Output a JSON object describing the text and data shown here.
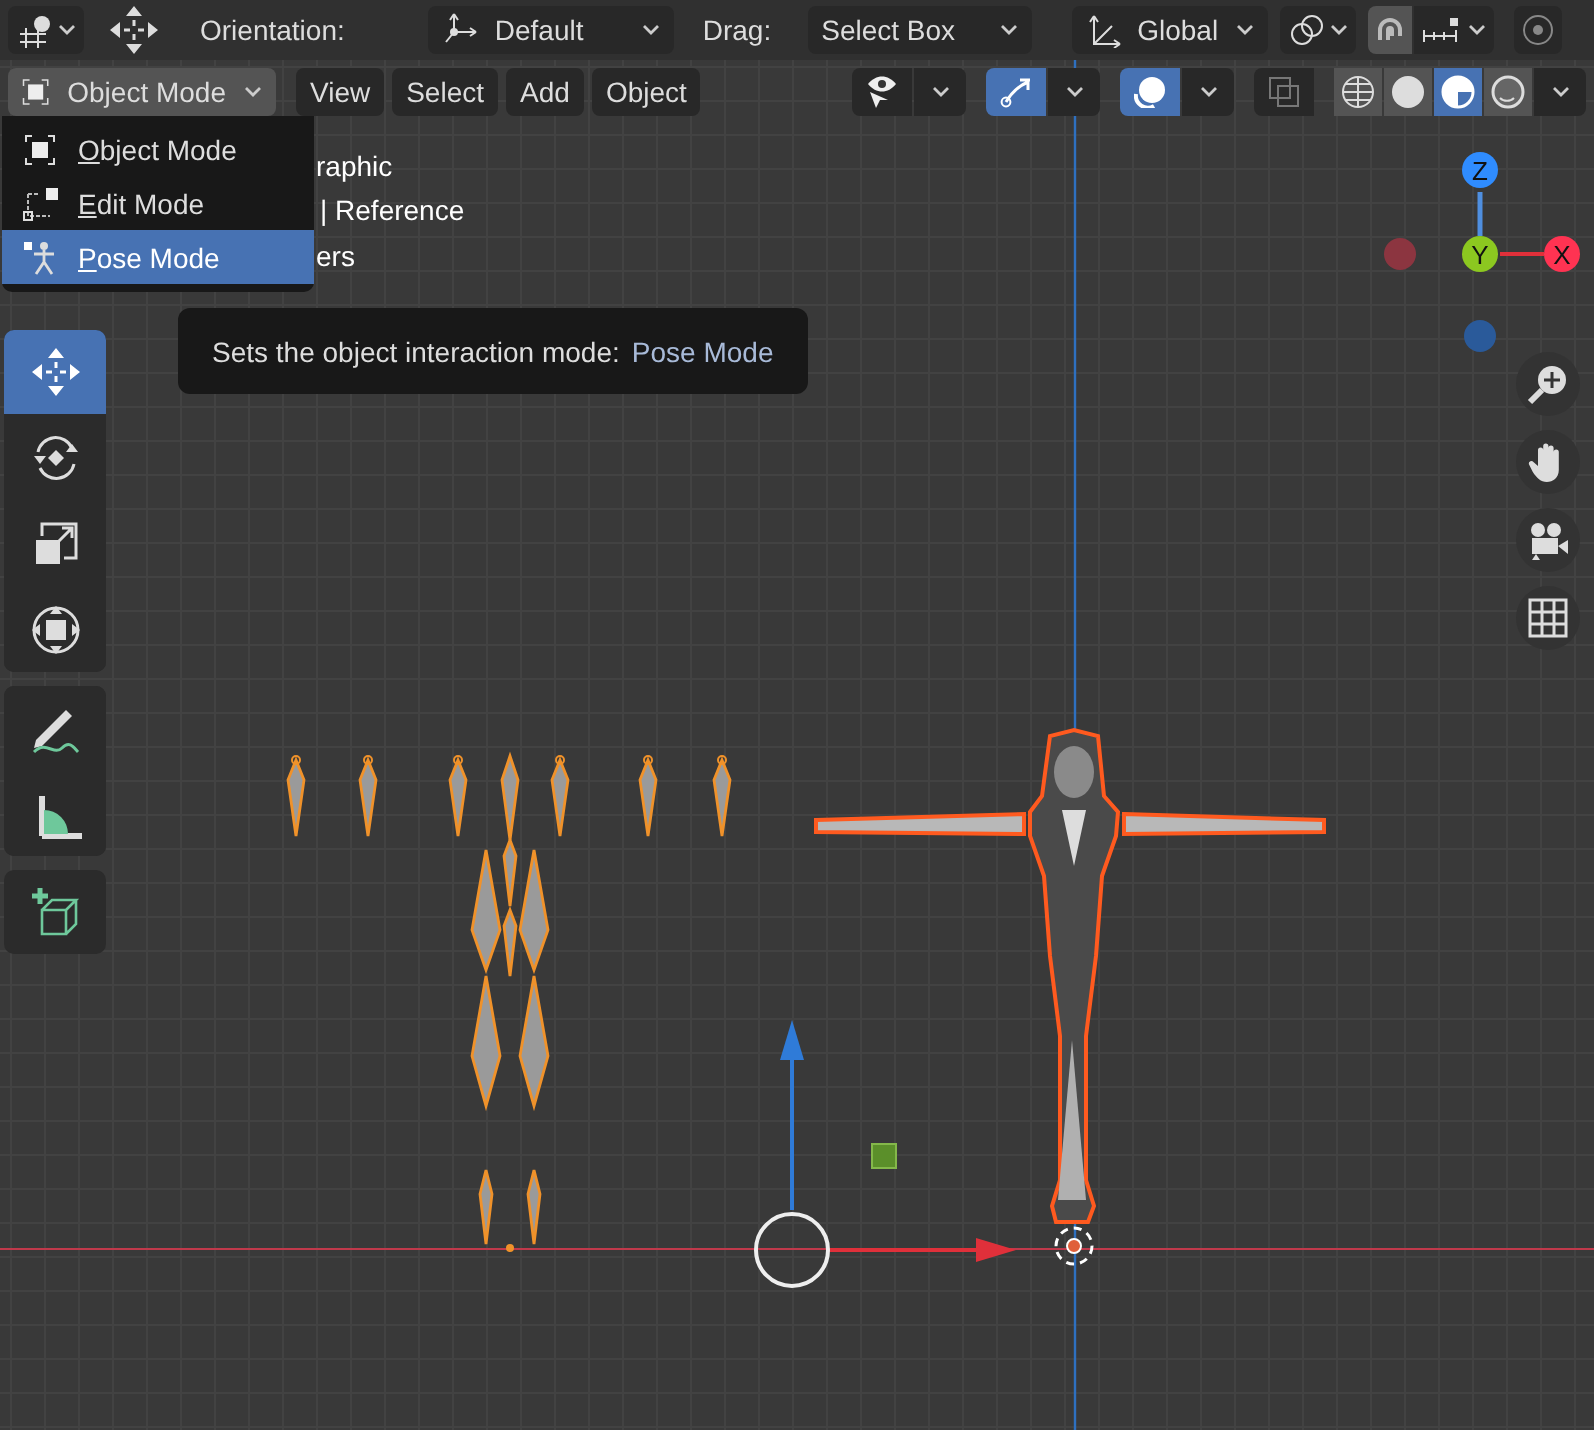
{
  "header": {
    "orientation_label": "Orientation:",
    "orientation": "Default",
    "drag_label": "Drag:",
    "drag": "Select Box",
    "transform_space": "Global"
  },
  "mode_button": {
    "label": "Object Mode"
  },
  "menus": [
    "View",
    "Select",
    "Add",
    "Object"
  ],
  "viewport_toggles": [
    {
      "kind": "visibility",
      "on": false
    },
    {
      "kind": "gizmo",
      "on": true
    },
    {
      "kind": "overlays",
      "on": true
    },
    {
      "kind": "xray",
      "on": false
    }
  ],
  "shading_modes": [
    {
      "kind": "wireframe",
      "selected": false
    },
    {
      "kind": "solid",
      "selected": false
    },
    {
      "kind": "material",
      "selected": true
    },
    {
      "kind": "rendered",
      "selected": false
    }
  ],
  "overlay_text": [
    "raphic",
    "| Reference",
    "ers"
  ],
  "mode_menu": [
    {
      "kind": "object",
      "label": "Object Mode",
      "selected": false
    },
    {
      "kind": "edit",
      "label": "Edit Mode",
      "selected": false
    },
    {
      "kind": "pose",
      "label": "Pose Mode",
      "selected": true
    }
  ],
  "tooltip": {
    "text": "Sets the object interaction mode:",
    "value": "Pose Mode"
  },
  "tools": [
    {
      "kind": "move",
      "selected": true
    },
    {
      "kind": "rotate",
      "selected": false
    },
    {
      "kind": "scale",
      "selected": false
    },
    {
      "kind": "transform",
      "selected": false
    },
    {
      "kind": "annotate",
      "selected": false
    },
    {
      "kind": "measure",
      "selected": false
    },
    {
      "kind": "add_cube",
      "selected": false
    }
  ],
  "gizmo": {
    "z": "Z",
    "y": "Y",
    "x": "X"
  }
}
